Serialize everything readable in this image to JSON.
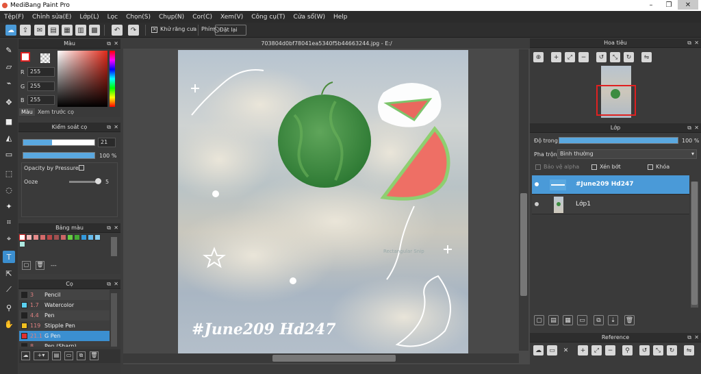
{
  "app": {
    "title": "MediBang Paint Pro"
  },
  "menu": [
    "Tệp(F)",
    "Chỉnh sửa(E)",
    "Lớp(L)",
    "Lọc",
    "Chọn(S)",
    "Chụp(N)",
    "Cor(C)",
    "Xem(V)",
    "Công cụ(T)",
    "Cửa sổ(W)",
    "Help"
  ],
  "toolbar": {
    "antialias_label": "Khử răng cưa",
    "key_label": "Phím",
    "reset_label": "Đặt lại"
  },
  "color_panel": {
    "title": "Màu",
    "r_label": "R",
    "g_label": "G",
    "b_label": "B",
    "r": "255",
    "g": "255",
    "b": "255",
    "tab_color": "Màu",
    "tab_preview": "Xem trước cọ"
  },
  "brush_control": {
    "title": "Kiểm soát cọ",
    "size": "21",
    "opacity": "100 %",
    "opacity_by_pressure": "Opacity by Pressure",
    "ooze_label": "Ooze",
    "ooze_value": "5"
  },
  "palette": {
    "title": "Bảng màu",
    "colors": [
      "#ffffff",
      "#f4b8b8",
      "#e58b8b",
      "#d46a6a",
      "#b84848",
      "#a05050",
      "#cc6666",
      "#66cc44",
      "#44aa33",
      "#3399dd",
      "#66bbee",
      "#88ccee",
      "#aee8e0"
    ],
    "selected_label": "---"
  },
  "brush_panel": {
    "title": "Cọ",
    "items": [
      {
        "size": "3",
        "name": "Pencil",
        "color": "#222222"
      },
      {
        "size": "1.7",
        "name": "Watercolor",
        "color": "#5ad0f0"
      },
      {
        "size": "4.4",
        "name": "Pen",
        "color": "#222222"
      },
      {
        "size": "119",
        "name": "Stipple Pen",
        "color": "#f0c020"
      },
      {
        "size": "21.1",
        "name": "G Pen",
        "color": "#e03030"
      },
      {
        "size": "8",
        "name": "Pen (Sharp)",
        "color": "#222222"
      }
    ],
    "selected_index": 4
  },
  "document": {
    "tab": "703804d0bf78041ea5340f5b44663244.jpg - E:/",
    "artwork_text": "#June209 Hd247",
    "watermark": "Rectangular Snip"
  },
  "navigator": {
    "title": "Hoa tiêu"
  },
  "layers": {
    "title": "Lớp",
    "opacity_label": "Độ trong",
    "opacity_value": "100 %",
    "blend_label": "Pha trộn",
    "blend_value": "Bình thường",
    "protect_alpha": "Bảo vệ alpha",
    "clip": "Xén bớt",
    "lock": "Khóa",
    "items": [
      {
        "name": "#June209 Hd247",
        "selected": true
      },
      {
        "name": "Lớp1",
        "selected": false
      }
    ]
  },
  "reference": {
    "title": "Reference"
  },
  "colors": {
    "accent": "#3b8fd0",
    "panel": "#3a3a3a",
    "selected_layer": "#4a9ad8"
  }
}
